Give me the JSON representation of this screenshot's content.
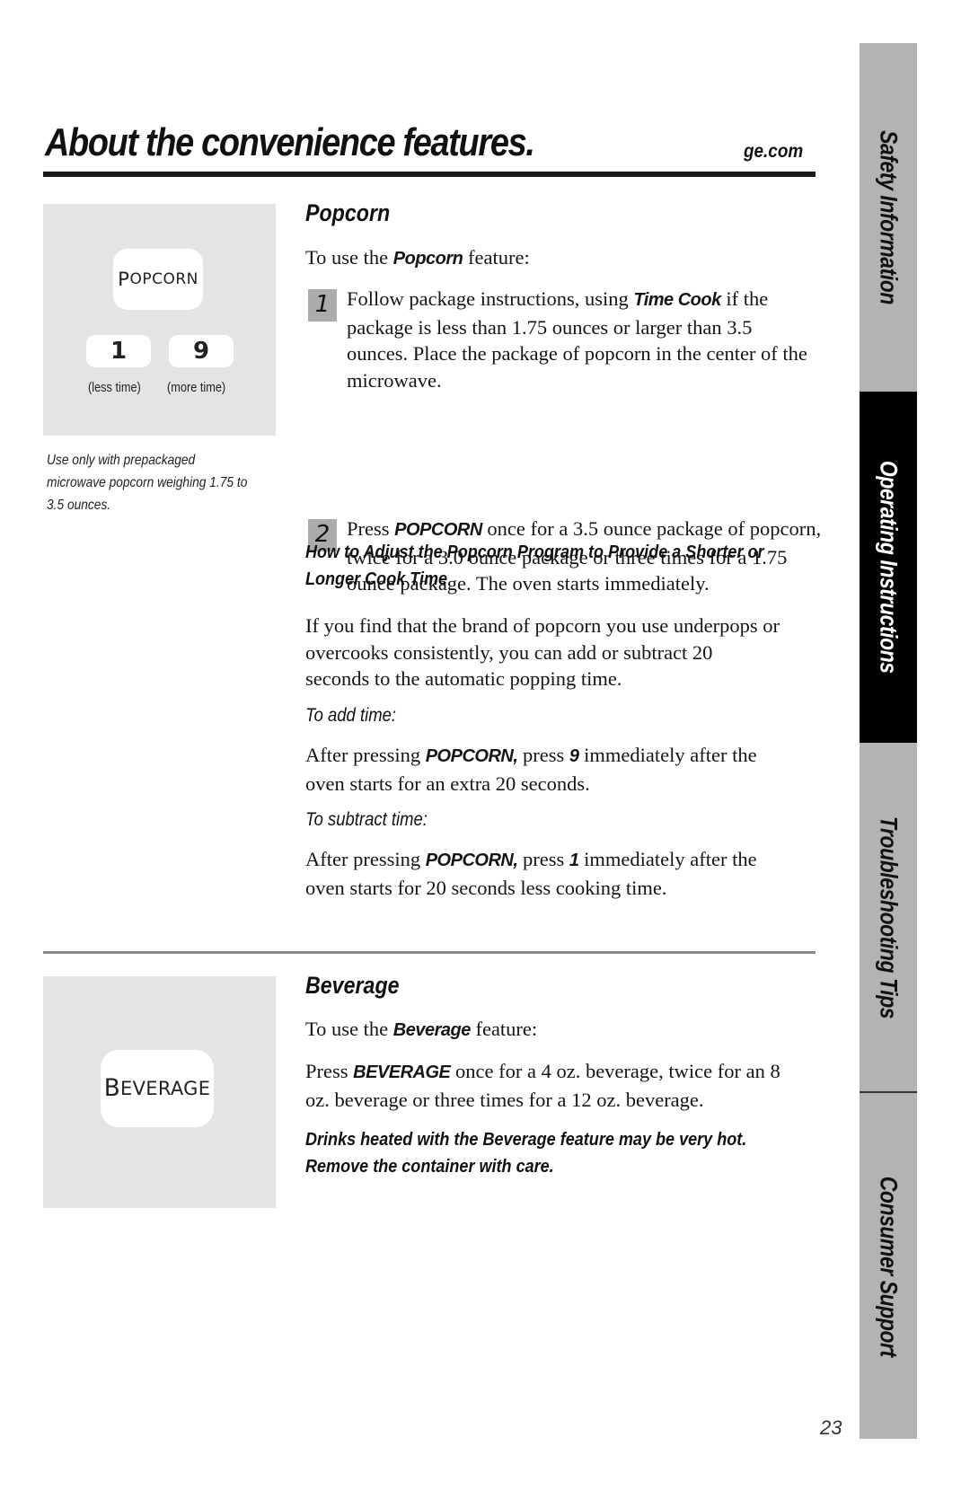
{
  "header": {
    "title": "About the convenience features.",
    "site": "ge.com"
  },
  "popcorn_panel": {
    "main_key": {
      "first": "P",
      "rest": "OPCORN"
    },
    "keys": [
      {
        "label": "1",
        "caption": "(less time)"
      },
      {
        "label": "9",
        "caption": "(more time)"
      }
    ],
    "note": "Use only with prepackaged microwave popcorn weighing 1.75 to 3.5 ounces."
  },
  "popcorn": {
    "heading": "Popcorn",
    "intro": {
      "before": "To use the ",
      "keyword": "Popcorn",
      "after": "  feature:"
    },
    "steps": [
      {
        "number": "1",
        "before": "Follow package instructions, using ",
        "keyword": "Time Cook",
        "after": " if the package is less than 1.75 ounces or larger than 3.5 ounces. Place the package of popcorn in the center of the microwave."
      },
      {
        "number": "2",
        "before": "Press ",
        "keyword": "POPCORN",
        "after": " once for a 3.5 ounce package of popcorn, twice for a 3.0 ounce package or three times for a 1.75 ounce package. The oven starts immediately."
      }
    ],
    "adjust_heading": "How to Adjust the Popcorn Program to Provide a Shorter or Longer Cook Time",
    "adjust_text": "If you find that the brand of popcorn you use underpops or overcooks consistently, you can add or subtract 20 seconds to the automatic popping time.",
    "add_time": {
      "label": "To add time:",
      "before": "After pressing ",
      "keyword": "POPCORN,",
      "mid": " press ",
      "key": "9",
      "after": "  immediately after the oven starts for an extra 20 seconds."
    },
    "subtract_time": {
      "label": "To subtract time:",
      "before": "After pressing ",
      "keyword": "POPCORN,",
      "mid": " press ",
      "key": "1",
      "after": "  immediately after the oven starts for 20 seconds less cooking time."
    }
  },
  "beverage_panel": {
    "main_key": {
      "first": "B",
      "rest": "EVERAGE"
    }
  },
  "beverage": {
    "heading": "Beverage",
    "intro": {
      "before": "To use the ",
      "keyword": "Beverage",
      "after": " feature:"
    },
    "instruction": {
      "before": "Press ",
      "keyword": "BEVERAGE",
      "after": "  once for a 4 oz. beverage, twice for an 8 oz. beverage or three times for a 12 oz. beverage."
    },
    "warning": "Drinks heated with the Beverage feature may be very hot. Remove the container with care."
  },
  "side_tabs": [
    {
      "label": "Safety Information",
      "active": false
    },
    {
      "label": "Operating Instructions",
      "active": true
    },
    {
      "label": "Troubleshooting Tips",
      "active": false
    },
    {
      "label": "Consumer Support",
      "active": false
    }
  ],
  "colors": {
    "tab_inactive": "#b3b3b3",
    "tab_active": "#000000",
    "panel_bg": "#e4e4e4",
    "step_badge": "#ababab"
  },
  "page_number": "23"
}
